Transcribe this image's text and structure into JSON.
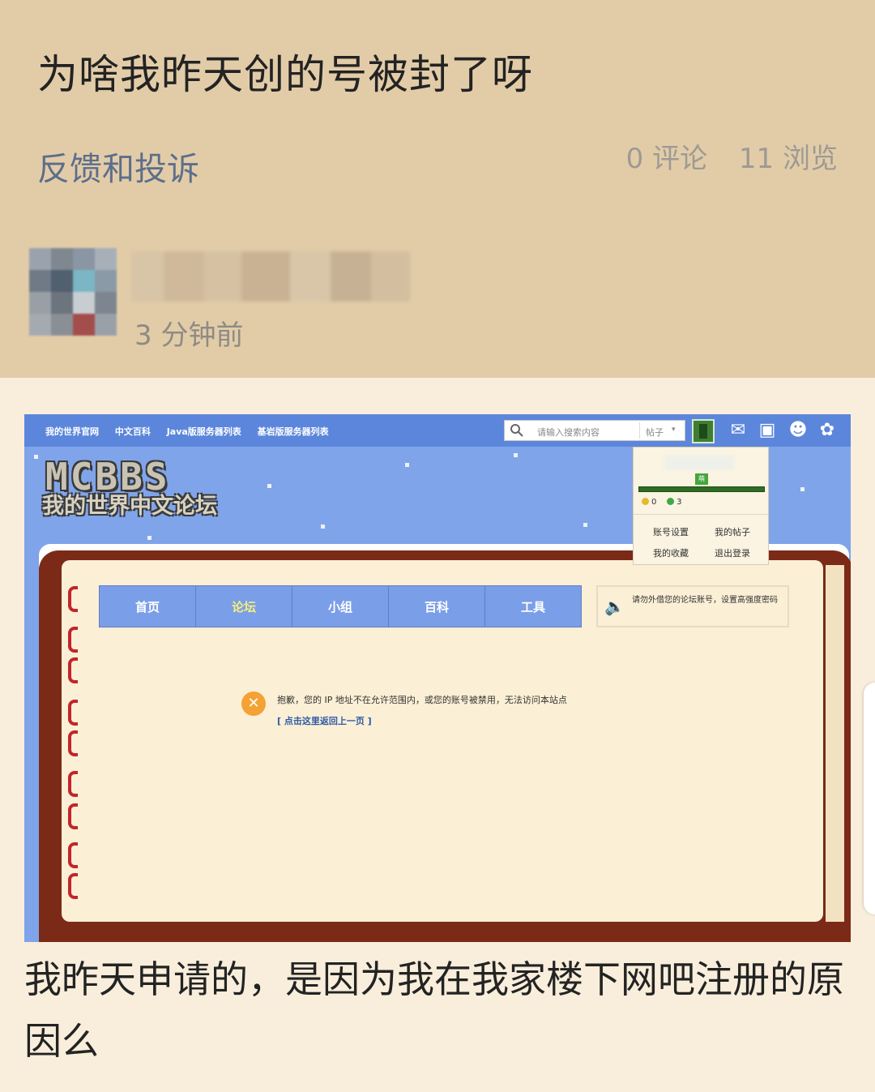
{
  "post": {
    "title": "为啥我昨天创的号被封了呀",
    "category": "反馈和投诉",
    "comments": "0 评论",
    "views": "11 浏览",
    "time": "3 分钟前",
    "body": "我昨天申请的，是因为我在我家楼下网吧注册的原因么"
  },
  "screenshot": {
    "nav_links": [
      "我的世界官网",
      "中文百科",
      "Java版服务器列表",
      "基岩版服务器列表"
    ],
    "search_placeholder": "请输入搜索内容",
    "search_scope": "帖子",
    "logo_main": "MCBBS",
    "logo_sub": "我的世界中文论坛",
    "tabs": [
      "首页",
      "论坛",
      "小组",
      "百科",
      "工具"
    ],
    "active_tab": "论坛",
    "notice": "请勿外借您的论坛账号，设置高强度密码",
    "error_message": "抱歉，您的 IP 地址不在允许范围内，或您的账号被禁用，无法访问本站点",
    "back_link": "[ 点击这里返回上一页 ]",
    "popup": {
      "badge": "萌",
      "gold": "0",
      "emerald": "3",
      "links": [
        "账号设置",
        "我的帖子",
        "我的收藏",
        "退出登录"
      ]
    }
  },
  "colors": {
    "header_bg": "#e2cca8",
    "page_bg": "#f8eedb",
    "category": "#5d6e8a",
    "forum_blue": "#7b9ee8",
    "book_brown": "#7b2a17"
  }
}
